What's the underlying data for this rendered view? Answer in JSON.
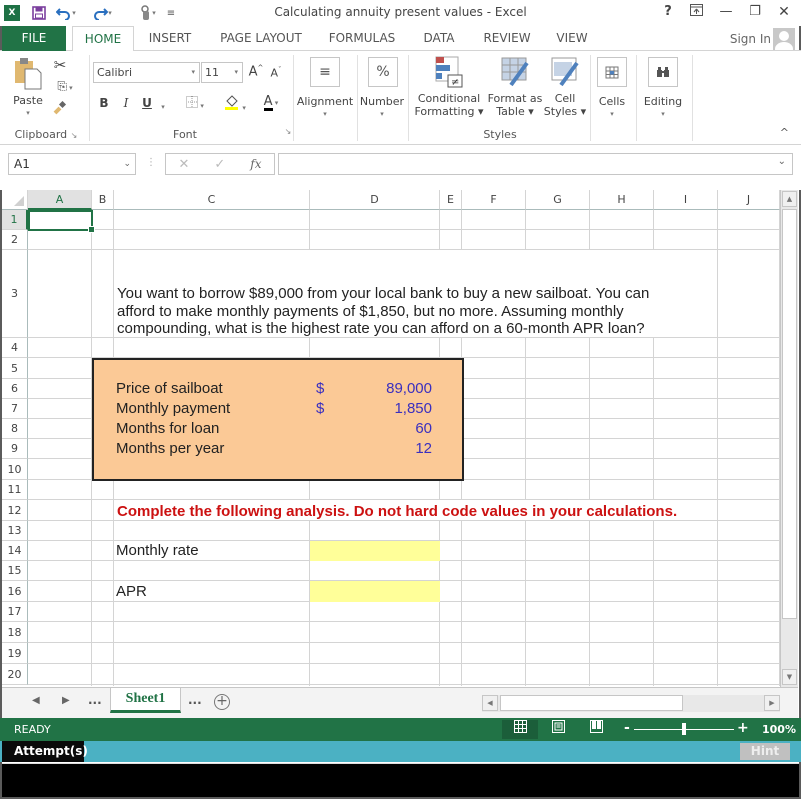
{
  "window": {
    "title": "Calculating annuity present values - Excel",
    "controls": {
      "help": "?",
      "ribbon_display": "⊼",
      "minimize": "—",
      "restore": "❐",
      "close": "✕"
    }
  },
  "quick_access": {
    "logo": "X",
    "save_icon": "save-icon",
    "undo_icon": "undo-icon",
    "redo_icon": "redo-icon",
    "touch_icon": "touch-mode-icon",
    "customize_icon": "customize-icon"
  },
  "ribbon_tabs": [
    {
      "label": "FILE"
    },
    {
      "label": "HOME"
    },
    {
      "label": "INSERT"
    },
    {
      "label": "PAGE LAYOUT"
    },
    {
      "label": "FORMULAS"
    },
    {
      "label": "DATA"
    },
    {
      "label": "REVIEW"
    },
    {
      "label": "VIEW"
    }
  ],
  "active_tab": "HOME",
  "sign_in": "Sign In",
  "ribbon": {
    "clipboard": {
      "paste": "Paste",
      "label": "Clipboard"
    },
    "font": {
      "family": "Calibri",
      "size": "11",
      "bold": "B",
      "italic": "I",
      "underline": "U",
      "grow": "A",
      "shrink": "A",
      "font_color": "A",
      "label": "Font",
      "highlight_color": "#ffff00",
      "text_color": "#000000"
    },
    "alignment": {
      "label": "Alignment",
      "icon": "≡"
    },
    "number": {
      "label": "Number",
      "icon": "%"
    },
    "styles": {
      "conditional": [
        "Conditional",
        "Formatting ▾"
      ],
      "format_table": [
        "Format as",
        "Table ▾"
      ],
      "cell_styles": [
        "Cell",
        "Styles ▾"
      ],
      "label": "Styles"
    },
    "cells": {
      "label": "Cells"
    },
    "editing": {
      "label": "Editing"
    }
  },
  "formula_bar": {
    "name_box": "A1",
    "cancel": "✕",
    "enter": "✓",
    "fx": "fx",
    "formula": ""
  },
  "columns": [
    "A",
    "B",
    "C",
    "D",
    "E",
    "F",
    "G",
    "H",
    "I",
    "J"
  ],
  "rows": [
    "1",
    "2",
    "3",
    "4",
    "5",
    "6",
    "7",
    "8",
    "9",
    "10",
    "11",
    "12",
    "13",
    "14",
    "15",
    "16",
    "17",
    "18",
    "19",
    "20"
  ],
  "selected_cell": "A1",
  "sheet": {
    "prompt_lines": [
      "You want to borrow $89,000 from your local bank to buy a new sailboat. You can",
      "afford to make monthly payments of $1,850, but no more. Assuming monthly",
      "compounding, what is the highest rate you can afford on a 60-month APR loan?"
    ],
    "inputs": [
      {
        "label": "Price of sailboat",
        "currency": "$",
        "value": "89,000"
      },
      {
        "label": "Monthly payment",
        "currency": "$",
        "value": "1,850"
      },
      {
        "label": "Months for loan",
        "currency": "",
        "value": "60"
      },
      {
        "label": "Months per year",
        "currency": "",
        "value": "12"
      }
    ],
    "instruction": "Complete the following analysis. Do not hard code values in your calculations.",
    "outputs": [
      {
        "label": "Monthly rate",
        "value": ""
      },
      {
        "label": "APR",
        "value": ""
      }
    ],
    "colors": {
      "input_box_fill": "#fbc996",
      "input_value_text": "#3a2fbf",
      "instruction_text": "#cc1111",
      "answer_fill": "#ffff99"
    }
  },
  "sheet_tabs": {
    "prev": "◀",
    "next": "▶",
    "more_left": "...",
    "active": "Sheet1",
    "more_right": "...",
    "add": "+"
  },
  "status_bar": {
    "mode": "READY",
    "zoom_minus": "-",
    "zoom_plus": "+",
    "zoom_level": "100%"
  },
  "attempts": {
    "label": "Attempt(s)",
    "hint": "Hint"
  }
}
